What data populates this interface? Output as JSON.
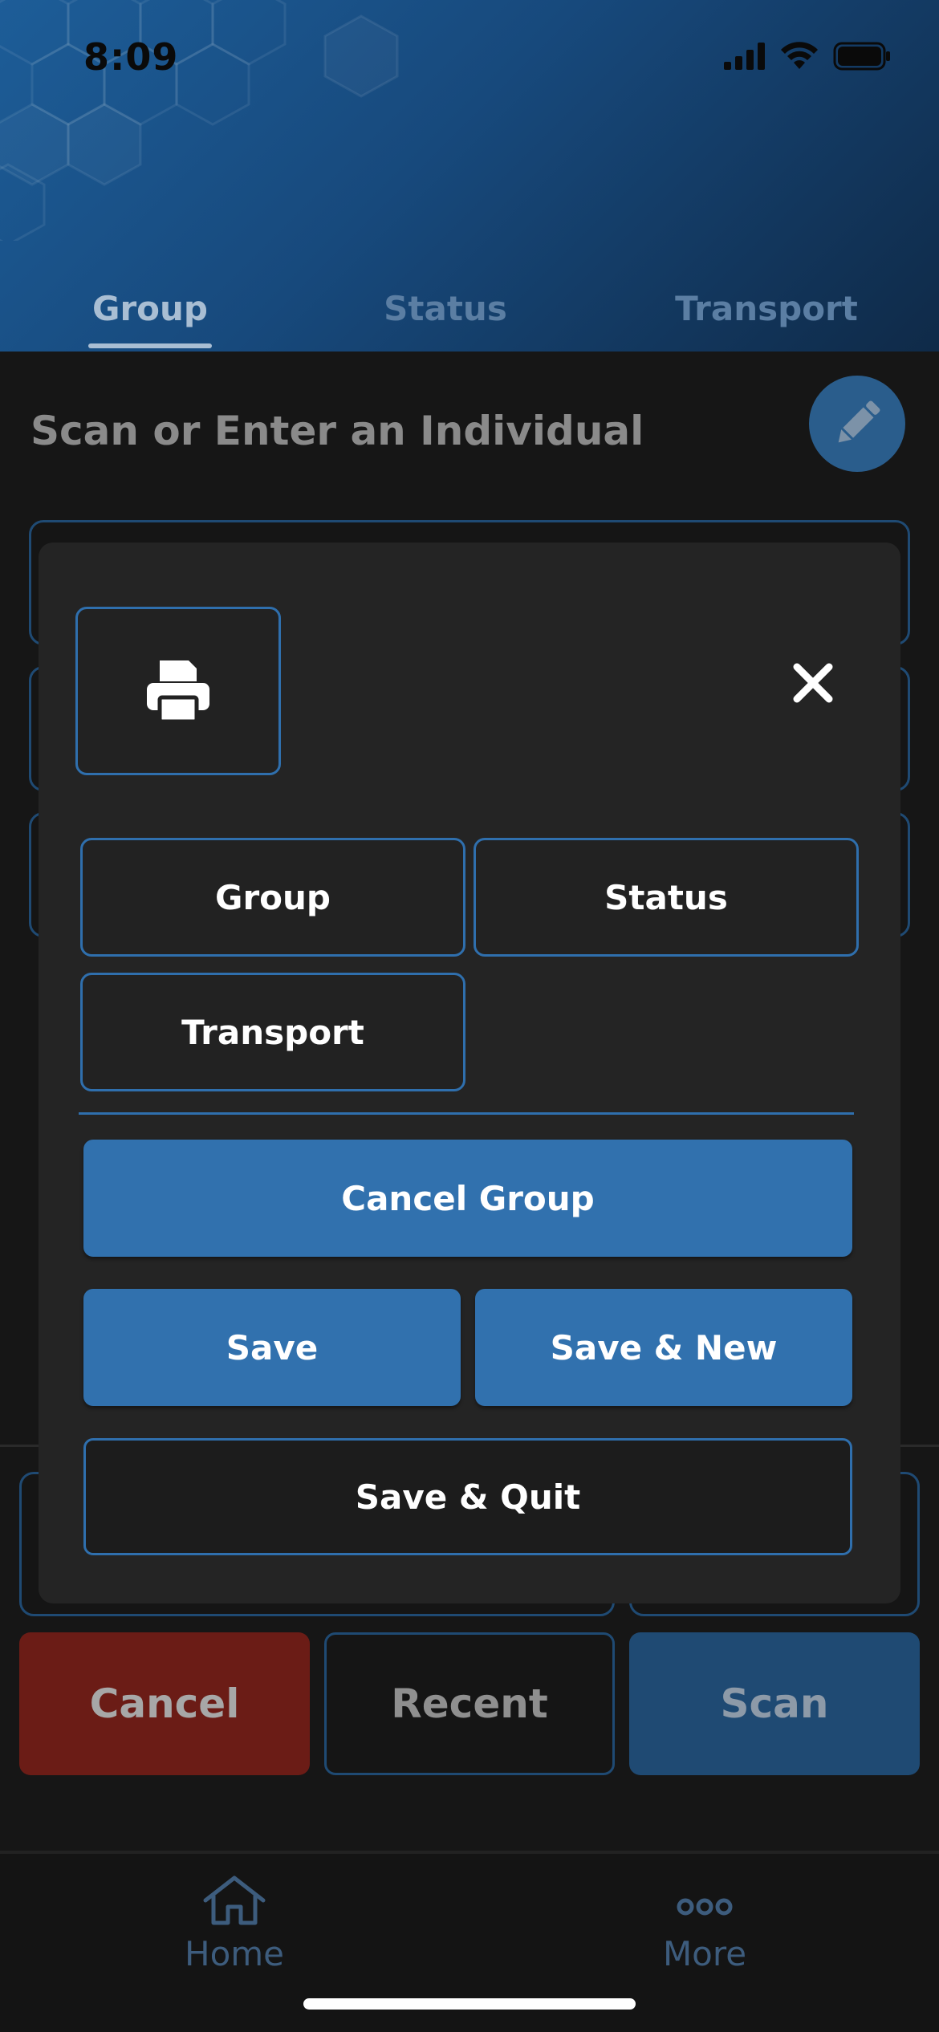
{
  "status_bar": {
    "time": "8:09",
    "icons": [
      "cellular-signal-icon",
      "wifi-icon",
      "battery-icon"
    ]
  },
  "tabs": [
    {
      "label": "Group",
      "active": true
    },
    {
      "label": "Status",
      "active": false
    },
    {
      "label": "Transport",
      "active": false
    }
  ],
  "page": {
    "title": "Scan or Enter an Individual",
    "edit_icon": "pencil-icon"
  },
  "modal": {
    "print_icon": "printer-icon",
    "close_icon": "close-icon",
    "options": [
      "Group",
      "Status",
      "Transport"
    ],
    "cancel_group": "Cancel Group",
    "save": "Save",
    "save_new": "Save & New",
    "save_quit": "Save & Quit"
  },
  "bottom_buttons": {
    "cancel": "Cancel",
    "recent": "Recent",
    "scan": "Scan"
  },
  "bottom_nav": [
    {
      "label": "Home",
      "icon": "home-icon"
    },
    {
      "label": "More",
      "icon": "more-icon"
    }
  ],
  "colors": {
    "accent": "#3171ae",
    "outline": "#2f6fad",
    "danger": "#6b1c16",
    "modal_bg": "#242424",
    "page_bg": "#161616"
  }
}
